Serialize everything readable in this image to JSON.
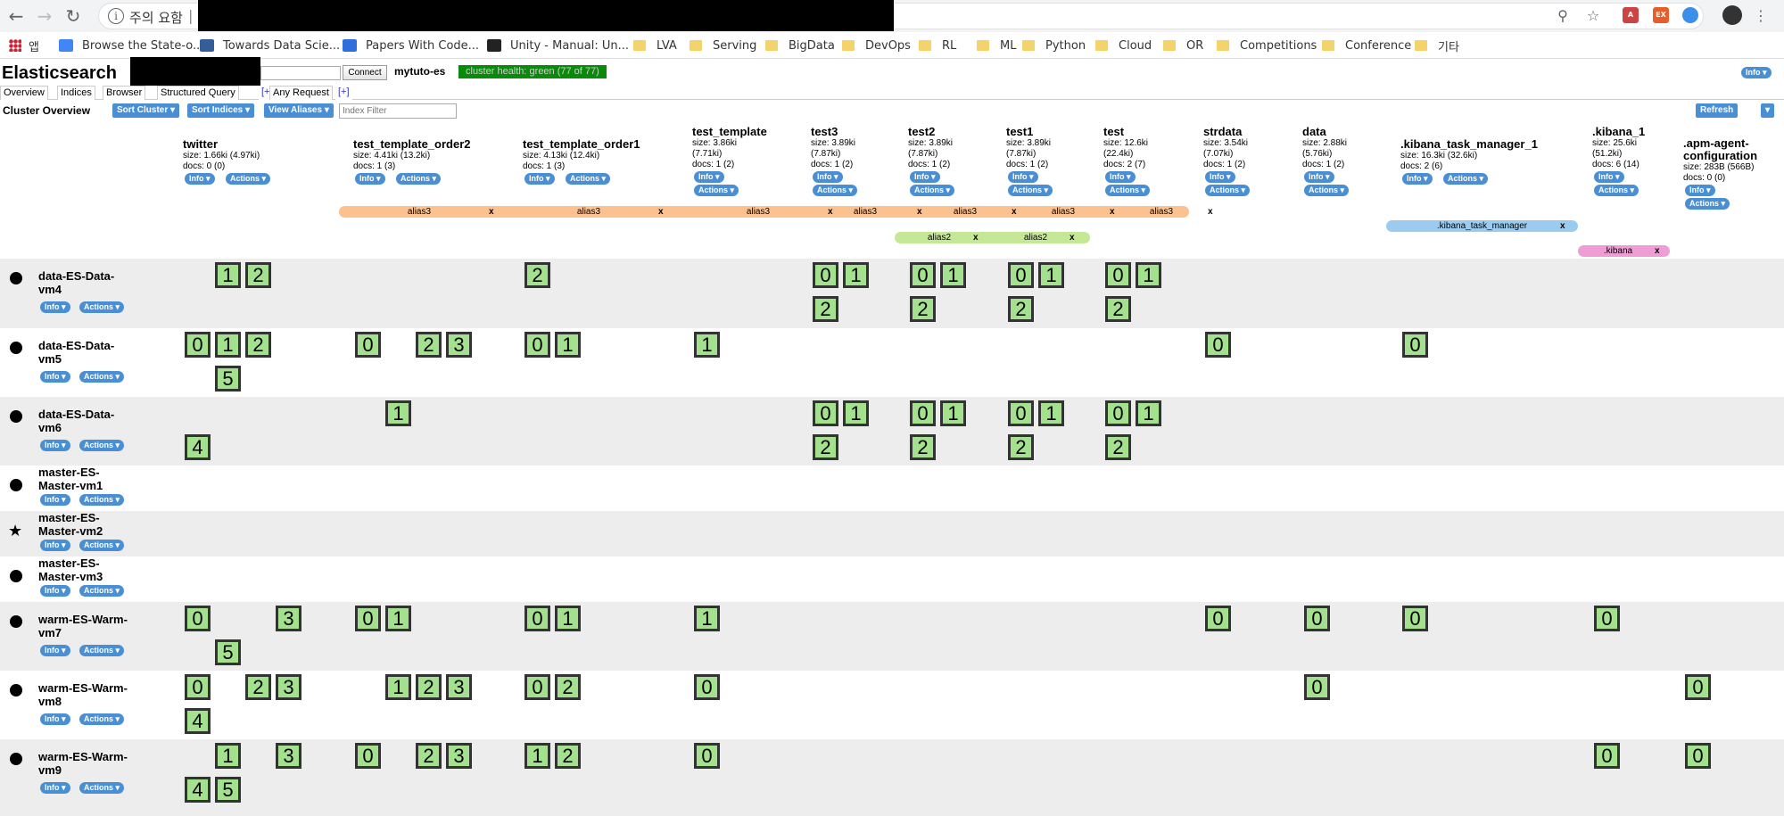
{
  "browser": {
    "security_label": "주의 요함",
    "bookmarks": [
      {
        "label": "앱",
        "icon": "apps-icon"
      },
      {
        "label": "Browse the State-o...",
        "icon": "favicon"
      },
      {
        "label": "Towards Data Scie...",
        "icon": "favicon"
      },
      {
        "label": "Papers With Code...",
        "icon": "favicon"
      },
      {
        "label": "Unity - Manual: Un...",
        "icon": "favicon"
      },
      {
        "label": "LVA",
        "icon": "folder-icon"
      },
      {
        "label": "Serving",
        "icon": "folder-icon"
      },
      {
        "label": "BigData",
        "icon": "folder-icon"
      },
      {
        "label": "DevOps",
        "icon": "folder-icon"
      },
      {
        "label": "RL",
        "icon": "folder-icon"
      },
      {
        "label": "ML",
        "icon": "folder-icon"
      },
      {
        "label": "Python",
        "icon": "folder-icon"
      },
      {
        "label": "Cloud",
        "icon": "folder-icon"
      },
      {
        "label": "OR",
        "icon": "folder-icon"
      },
      {
        "label": "Competitions",
        "icon": "folder-icon"
      },
      {
        "label": "Conference",
        "icon": "folder-icon"
      },
      {
        "label": "기타",
        "icon": "folder-icon"
      }
    ]
  },
  "app": {
    "title": "Elasticsearch",
    "connect_label": "Connect",
    "cluster_name": "mytuto-es",
    "health": "cluster health: green (77 of 77)",
    "health_color": "#0a8a0a",
    "info_label": "Info"
  },
  "tabs": [
    "Overview",
    "Indices",
    "Browser",
    "Structured Query",
    "[+]",
    "Any Request",
    "[+]"
  ],
  "toolbar": {
    "title": "Cluster Overview",
    "sort_cluster": "Sort Cluster",
    "sort_indices": "Sort Indices",
    "view_aliases": "View Aliases",
    "filter_placeholder": "Index Filter",
    "refresh": "Refresh"
  },
  "pill_labels": {
    "info": "Info",
    "actions": "Actions"
  },
  "indices": [
    {
      "name": "twitter",
      "meta": [
        "size: 1.66ki (4.97ki)",
        "docs: 0 (0)"
      ]
    },
    {
      "name": "test_template_order2",
      "meta": [
        "size: 4.41ki (13.2ki)",
        "docs: 1 (3)"
      ]
    },
    {
      "name": "test_template_order1",
      "meta": [
        "size: 4.13ki (12.4ki)",
        "docs: 1 (3)"
      ]
    },
    {
      "name": "test_template",
      "meta": [
        "size: 3.86ki",
        "(7.71ki)",
        "docs: 1 (2)"
      ]
    },
    {
      "name": "test3",
      "meta": [
        "size: 3.89ki",
        "(7.87ki)",
        "docs: 1 (2)"
      ]
    },
    {
      "name": "test2",
      "meta": [
        "size: 3.89ki",
        "(7.87ki)",
        "docs: 1 (2)"
      ]
    },
    {
      "name": "test1",
      "meta": [
        "size: 3.89ki",
        "(7.87ki)",
        "docs: 1 (2)"
      ]
    },
    {
      "name": "test",
      "meta": [
        "size: 12.6ki",
        "(22.4ki)",
        "docs: 2 (7)"
      ]
    },
    {
      "name": "strdata",
      "meta": [
        "size: 3.54ki",
        "(7.07ki)",
        "docs: 1 (2)"
      ]
    },
    {
      "name": "data",
      "meta": [
        "size: 2.88ki",
        "(5.76ki)",
        "docs: 1 (2)"
      ]
    },
    {
      "name": ".kibana_task_manager_1",
      "meta": [
        "size: 16.3ki (32.6ki)",
        "docs: 2 (6)"
      ]
    },
    {
      "name": ".kibana_1",
      "meta": [
        "size: 25.6ki",
        "(51.2ki)",
        "docs: 6 (14)"
      ]
    },
    {
      "name": ".apm-agent-configuration",
      "meta": [
        "size: 283B (566B)",
        "docs: 0 (0)"
      ]
    }
  ],
  "aliases": {
    "alias3": {
      "label": "alias3",
      "color": "#fbc18f"
    },
    "alias2": {
      "label": "alias2",
      "color": "#c5e897"
    },
    "kibana_task_manager": {
      "label": ".kibana_task_manager",
      "color": "#9ccbf0"
    },
    "kibana": {
      "label": ".kibana",
      "color": "#ee9ed4"
    },
    "remove": "x"
  },
  "shard_color": "#a3e18e",
  "nodes": [
    {
      "name": "data-ES-Data-vm4",
      "master": false
    },
    {
      "name": "data-ES-Data-vm5",
      "master": false
    },
    {
      "name": "data-ES-Data-vm6",
      "master": false
    },
    {
      "name": "master-ES-Master-vm1",
      "master": false
    },
    {
      "name": "master-ES-Master-vm2",
      "master": true
    },
    {
      "name": "master-ES-Master-vm3",
      "master": false
    },
    {
      "name": "warm-ES-Warm-vm7",
      "master": false
    },
    {
      "name": "warm-ES-Warm-vm8",
      "master": false
    },
    {
      "name": "warm-ES-Warm-vm9",
      "master": false
    }
  ],
  "shards": [
    [
      {
        "index": 0,
        "ids": [
          1,
          2
        ],
        "second": []
      },
      {
        "index": 2,
        "ids": [
          2
        ],
        "second": []
      },
      {
        "index": 4,
        "ids": [
          0,
          1
        ],
        "second": [
          2
        ]
      },
      {
        "index": 5,
        "ids": [
          0,
          1
        ],
        "second": [
          2
        ]
      },
      {
        "index": 6,
        "ids": [
          0,
          1
        ],
        "second": [
          2
        ]
      },
      {
        "index": 7,
        "ids": [
          0,
          1
        ],
        "second": [
          2
        ]
      }
    ],
    [
      {
        "index": 0,
        "ids": [
          0,
          1,
          2
        ],
        "second": [
          5
        ]
      },
      {
        "index": 1,
        "ids": [
          0,
          2,
          3
        ],
        "second": []
      },
      {
        "index": 2,
        "ids": [
          0,
          1
        ],
        "second": []
      },
      {
        "index": 3,
        "ids": [
          1
        ],
        "second": []
      },
      {
        "index": 8,
        "ids": [
          0
        ],
        "second": []
      },
      {
        "index": 10,
        "ids": [
          0
        ],
        "second": []
      }
    ],
    [
      {
        "index": 0,
        "ids": [],
        "second": [
          4
        ]
      },
      {
        "index": 1,
        "ids": [
          1
        ],
        "second": []
      },
      {
        "index": 4,
        "ids": [
          0,
          1
        ],
        "second": [
          2
        ]
      },
      {
        "index": 5,
        "ids": [
          0,
          1
        ],
        "second": [
          2
        ]
      },
      {
        "index": 6,
        "ids": [
          0,
          1
        ],
        "second": [
          2
        ]
      },
      {
        "index": 7,
        "ids": [
          0,
          1
        ],
        "second": [
          2
        ]
      }
    ],
    [],
    [],
    [],
    [
      {
        "index": 0,
        "ids": [
          0,
          3
        ],
        "second": [
          5
        ]
      },
      {
        "index": 1,
        "ids": [
          0,
          1
        ],
        "second": []
      },
      {
        "index": 2,
        "ids": [
          0,
          1
        ],
        "second": []
      },
      {
        "index": 3,
        "ids": [
          1
        ],
        "second": []
      },
      {
        "index": 8,
        "ids": [
          0
        ],
        "second": []
      },
      {
        "index": 9,
        "ids": [
          0
        ],
        "second": []
      },
      {
        "index": 10,
        "ids": [
          0
        ],
        "second": []
      },
      {
        "index": 11,
        "ids": [
          0
        ],
        "second": []
      }
    ],
    [
      {
        "index": 0,
        "ids": [
          0,
          2,
          3
        ],
        "second": [
          4
        ]
      },
      {
        "index": 1,
        "ids": [
          1,
          2,
          3
        ],
        "second": []
      },
      {
        "index": 2,
        "ids": [
          0,
          2
        ],
        "second": []
      },
      {
        "index": 3,
        "ids": [
          0
        ],
        "second": []
      },
      {
        "index": 9,
        "ids": [
          0
        ],
        "second": []
      },
      {
        "index": 12,
        "ids": [
          0
        ],
        "second": []
      }
    ],
    [
      {
        "index": 0,
        "ids": [
          1,
          3
        ],
        "second": [
          4,
          5
        ]
      },
      {
        "index": 1,
        "ids": [
          0,
          2,
          3
        ],
        "second": []
      },
      {
        "index": 2,
        "ids": [
          1,
          2
        ],
        "second": []
      },
      {
        "index": 3,
        "ids": [
          0
        ],
        "second": []
      },
      {
        "index": 11,
        "ids": [
          0
        ],
        "second": []
      },
      {
        "index": 12,
        "ids": [
          0
        ],
        "second": []
      }
    ]
  ]
}
